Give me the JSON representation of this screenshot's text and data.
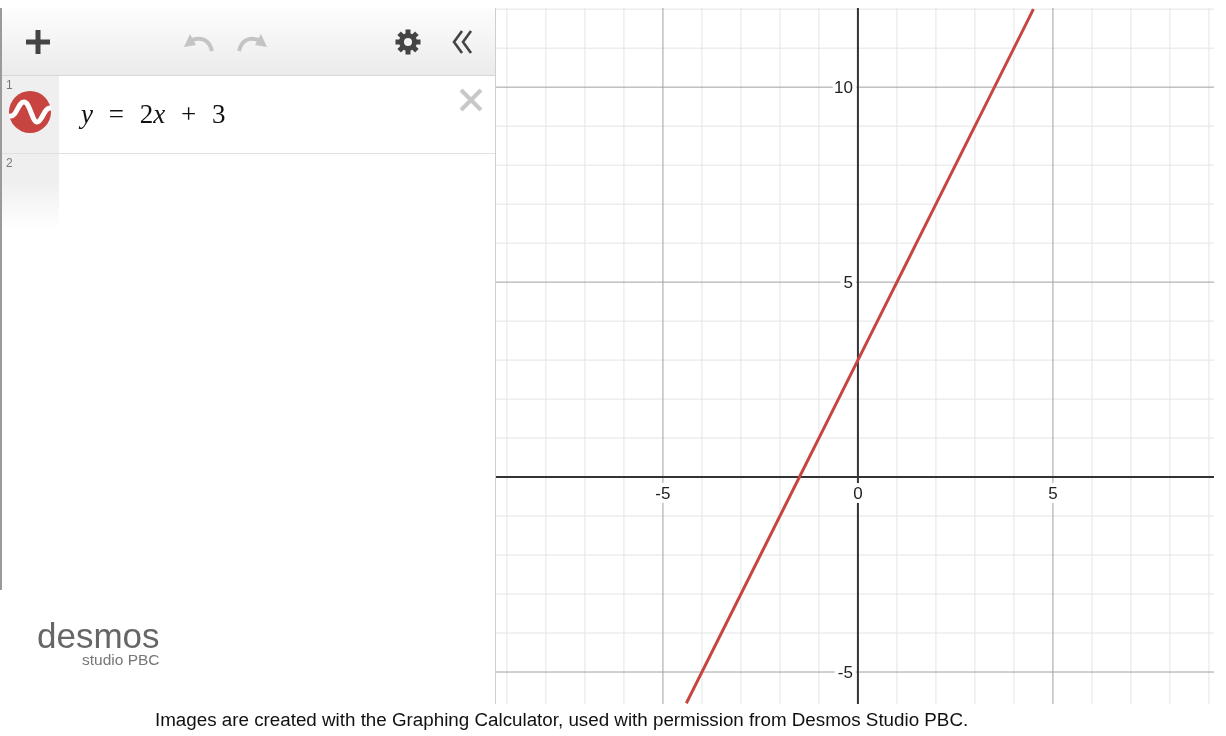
{
  "toolbar": {
    "undo": {
      "disabled": true
    },
    "redo": {
      "disabled": true
    }
  },
  "expressions": [
    {
      "number": "1",
      "expression": "y = 2x + 3",
      "color": "#c74440"
    },
    {
      "number": "2"
    }
  ],
  "logo": {
    "wordmark": "desmos",
    "subtitle": "studio PBC"
  },
  "graph": {
    "chart_data": {
      "type": "line",
      "xlim": [
        -9.28,
        9.13
      ],
      "ylim": [
        -5.82,
        12.03
      ],
      "xticks": [
        -5,
        0,
        5
      ],
      "yticks": [
        -5,
        5,
        10
      ],
      "grid": true,
      "x": [
        -4.4,
        4.5
      ],
      "series": [
        {
          "color": "#c74440",
          "values": [
            -5.8,
            12
          ]
        }
      ]
    }
  },
  "caption": "Images are created with the Graphing Calculator, used with permission from Desmos Studio PBC."
}
